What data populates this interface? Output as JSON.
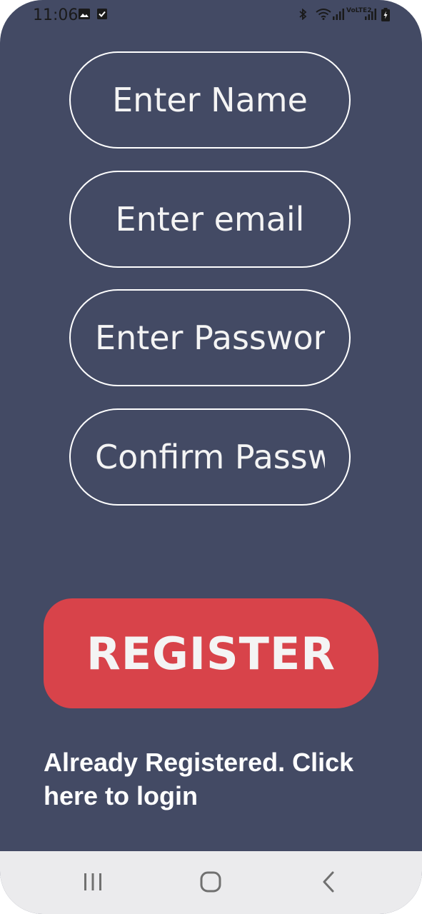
{
  "status_bar": {
    "time": "11:06",
    "left_icons": [
      "image-icon",
      "checkbox-icon"
    ],
    "right_icons": [
      "bluetooth-icon",
      "wifi-icon",
      "signal-icon",
      "volte-icon",
      "signal-icon",
      "battery-charging-icon"
    ],
    "network_label": "VoLTE2"
  },
  "form": {
    "name_placeholder": "Enter Name",
    "email_placeholder": "Enter email",
    "password_placeholder": "Enter Password",
    "confirm_placeholder": "Confirm Password"
  },
  "register_label": "REGISTER",
  "login_link_text": "Already Registered. Click here to login",
  "nav_bar": {
    "recents": "recents-icon",
    "home": "home-icon",
    "back": "back-icon"
  },
  "colors": {
    "background": "#434a64",
    "button": "#d8434a",
    "text": "#ffffff",
    "nav_bar": "#ebebed"
  }
}
